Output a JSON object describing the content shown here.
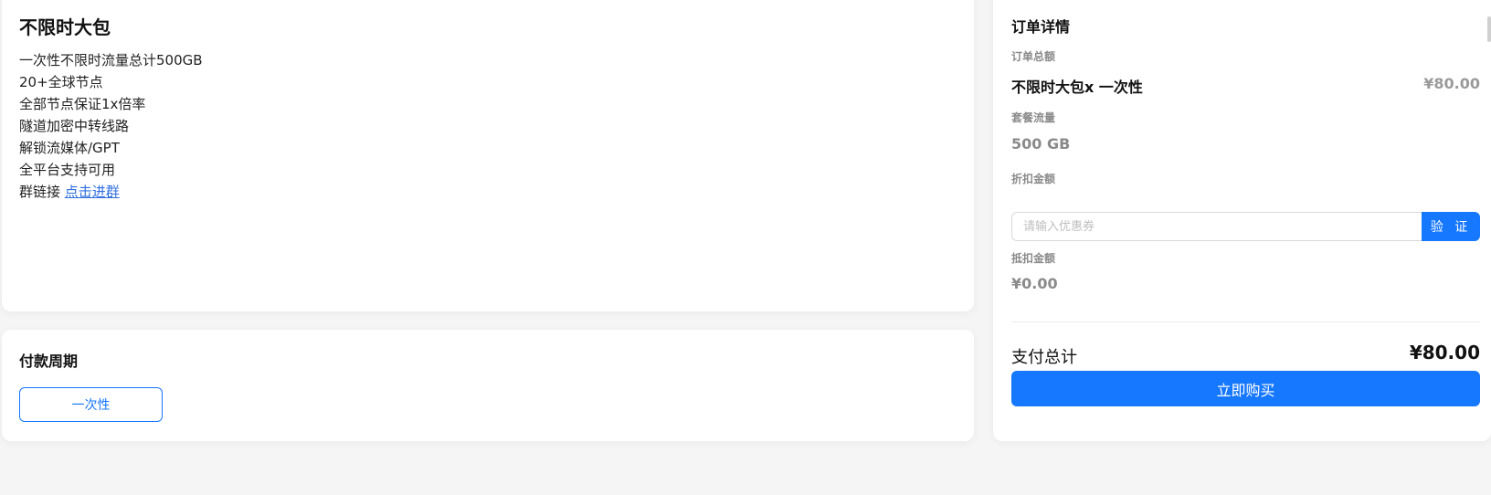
{
  "plan": {
    "title": "不限时大包",
    "features": [
      "一次性不限时流量总计500GB",
      "20+全球节点",
      "全部节点保证1x倍率",
      "隧道加密中转线路",
      "解锁流媒体/GPT",
      "全平台支持可用"
    ],
    "group_prefix": "群链接 ",
    "group_link": "点击进群"
  },
  "cycle": {
    "title": "付款周期",
    "option": "一次性"
  },
  "order": {
    "title": "订单详情",
    "total_amount_label": "订单总额",
    "item_name": "不限时大包x 一次性",
    "item_price": "¥80.00",
    "traffic_label": "套餐流量",
    "traffic_value": "500 GB",
    "discount_label": "折扣金额",
    "coupon_placeholder": "请输入优惠券",
    "verify_label": "验 证",
    "deduction_label": "抵扣金额",
    "deduction_value": "¥0.00",
    "total_label": "支付总计",
    "total_value": "¥80.00",
    "buy_label": "立即购买"
  },
  "colors": {
    "accent": "#1677ff",
    "link": "#2f6fe0",
    "muted": "#8a8a8a"
  }
}
